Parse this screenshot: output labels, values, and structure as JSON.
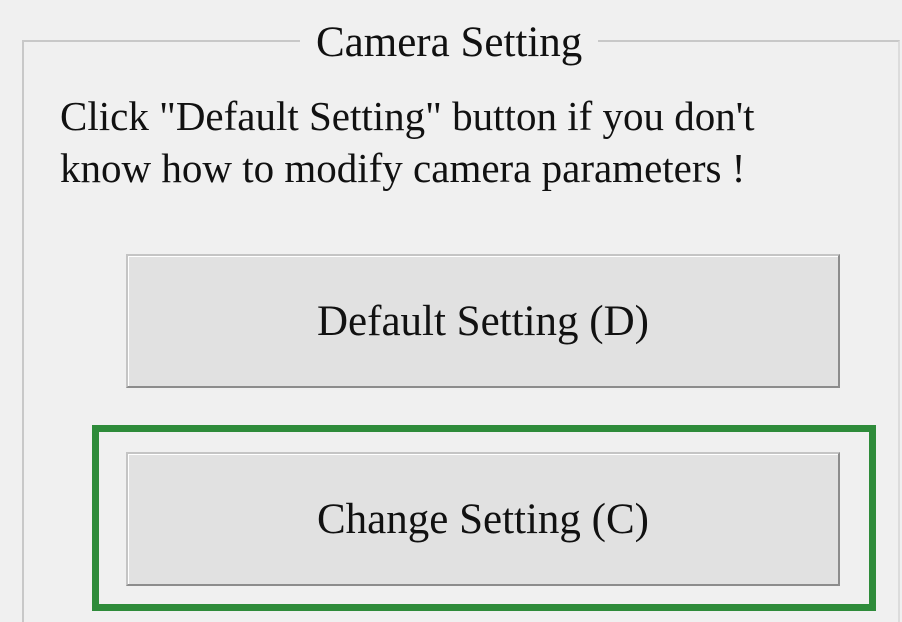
{
  "group": {
    "title": "Camera Setting"
  },
  "instruction": {
    "line1": "Click \"Default Setting\" button if you don't",
    "line2": "know how to modify camera parameters !"
  },
  "buttons": {
    "default_label": "Default Setting (D)",
    "change_label": "Change Setting (C)"
  },
  "highlight": {
    "target": "change-setting-button",
    "color": "#2e8b3a"
  }
}
